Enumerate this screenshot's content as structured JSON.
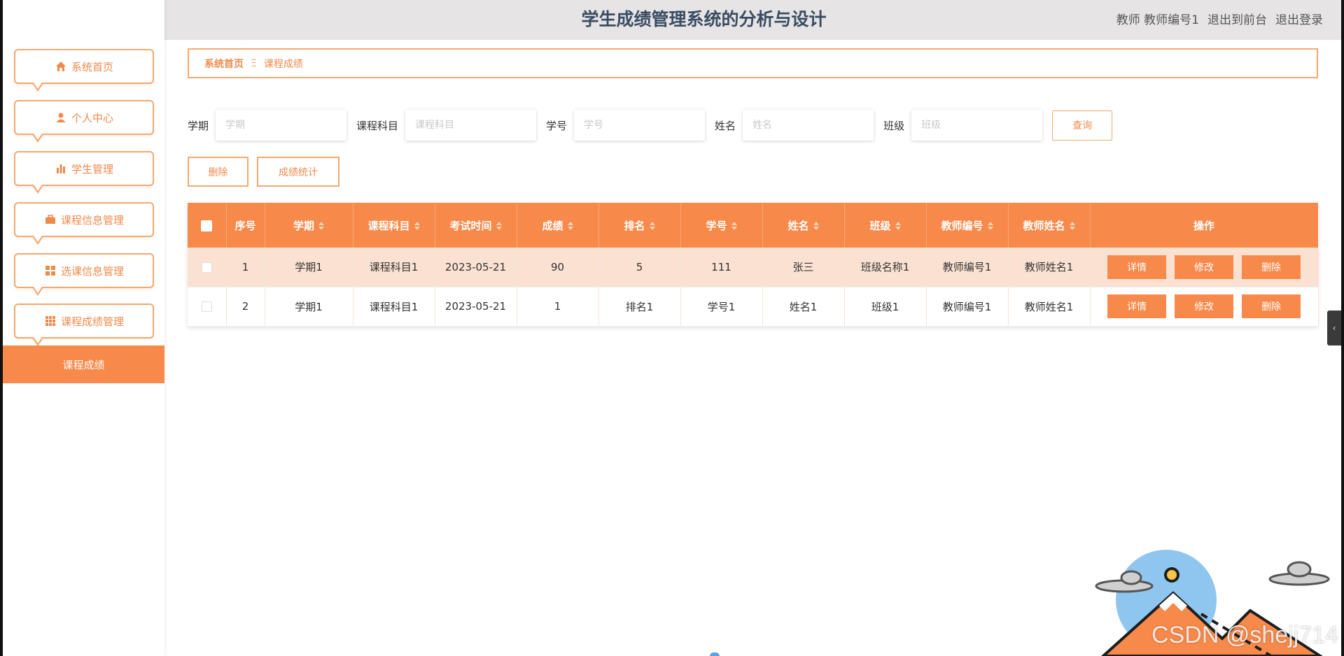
{
  "header": {
    "title": "学生成绩管理系统的分析与设计",
    "user_label": "教师 教师编号1",
    "exit_front": "退出到前台",
    "logout": "退出登录"
  },
  "sidebar": {
    "items": [
      {
        "label": "系统首页",
        "icon": "home-icon"
      },
      {
        "label": "个人中心",
        "icon": "user-icon"
      },
      {
        "label": "学生管理",
        "icon": "bar-chart-icon"
      },
      {
        "label": "课程信息管理",
        "icon": "briefcase-icon"
      },
      {
        "label": "选课信息管理",
        "icon": "grid-icon"
      },
      {
        "label": "课程成绩管理",
        "icon": "apps-icon"
      }
    ],
    "active_sub": "课程成绩"
  },
  "breadcrumb": {
    "home": "系统首页",
    "sep": "Ξ",
    "current": "课程成绩"
  },
  "search": {
    "fields": [
      {
        "label": "学期",
        "placeholder": "学期"
      },
      {
        "label": "课程科目",
        "placeholder": "课程科目"
      },
      {
        "label": "学号",
        "placeholder": "学号"
      },
      {
        "label": "姓名",
        "placeholder": "姓名"
      },
      {
        "label": "班级",
        "placeholder": "班级"
      }
    ],
    "query_label": "查询"
  },
  "actions": {
    "delete_label": "删除",
    "stats_label": "成绩统计"
  },
  "table": {
    "columns": [
      "序号",
      "学期",
      "课程科目",
      "考试时间",
      "成绩",
      "排名",
      "学号",
      "姓名",
      "班级",
      "教师编号",
      "教师姓名",
      "操作"
    ],
    "rows": [
      {
        "no": "1",
        "term": "学期1",
        "subject": "课程科目1",
        "date": "2023-05-21",
        "score": "90",
        "rank": "5",
        "sid": "111",
        "name": "张三",
        "class": "班级名称1",
        "tid": "教师编号1",
        "tname": "教师姓名1"
      },
      {
        "no": "2",
        "term": "学期1",
        "subject": "课程科目1",
        "date": "2023-05-21",
        "score": "1",
        "rank": "排名1",
        "sid": "学号1",
        "name": "姓名1",
        "class": "班级1",
        "tid": "教师编号1",
        "tname": "教师姓名1"
      }
    ],
    "op_labels": {
      "detail": "详情",
      "edit": "修改",
      "delete": "删除"
    }
  },
  "watermark": "CSDN @shejj714",
  "colors": {
    "accent": "#f7894a",
    "border": "#f5a870",
    "header_bg": "#e6e4e4",
    "title": "#3a4c63",
    "row_highlight": "#fbe1d2"
  }
}
